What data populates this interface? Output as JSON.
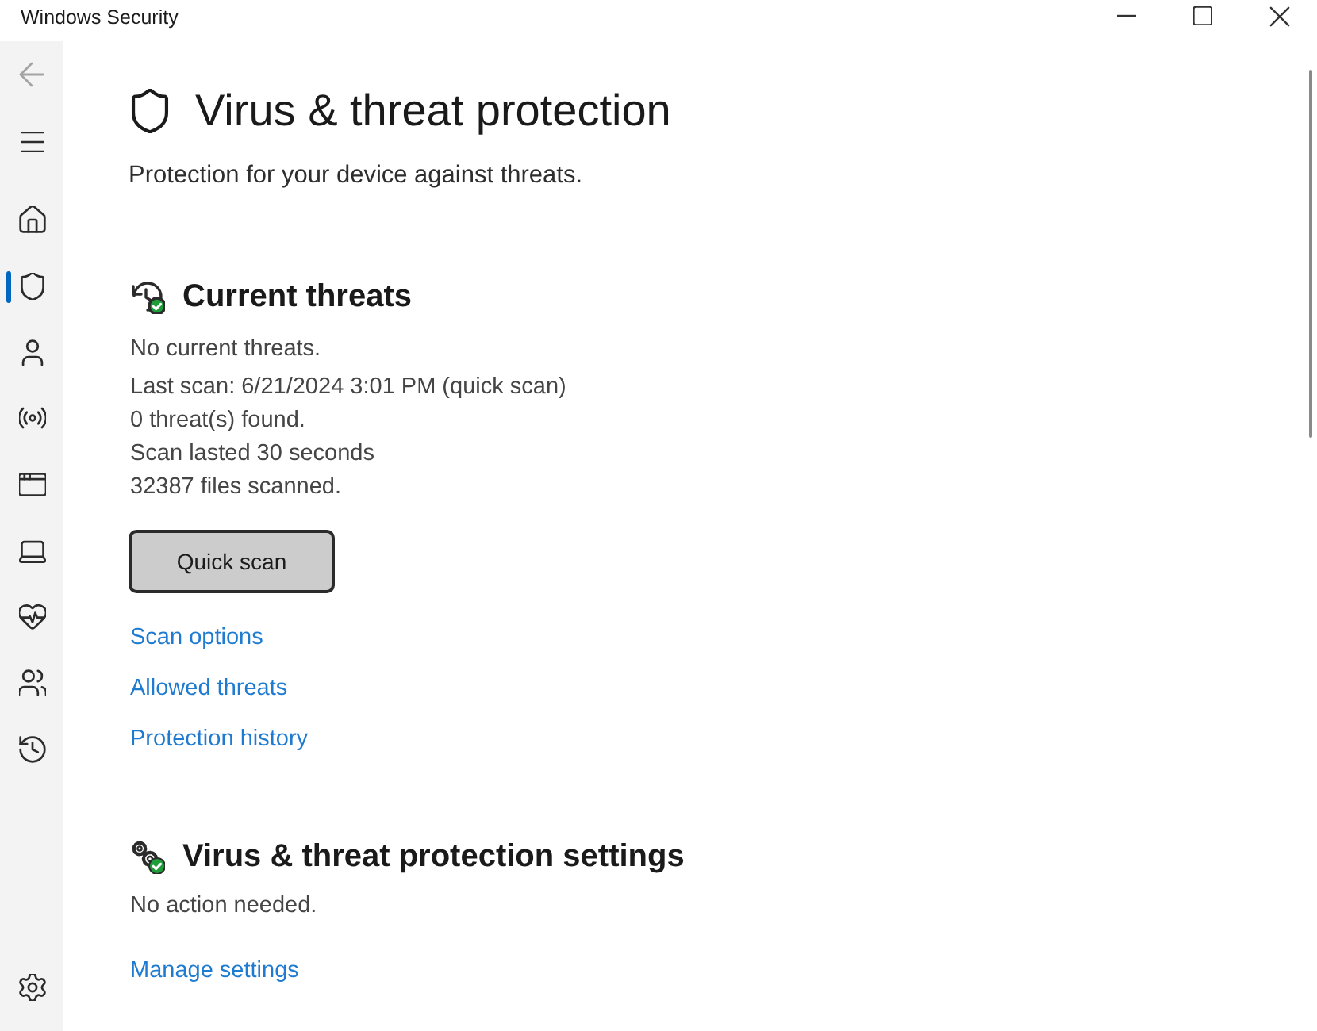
{
  "window": {
    "title": "Windows Security"
  },
  "sidebar": {
    "back": {
      "disabled": true
    },
    "items": [
      {
        "kind": "home",
        "selected": false
      },
      {
        "kind": "shield",
        "selected": true
      },
      {
        "kind": "account",
        "selected": false
      },
      {
        "kind": "network",
        "selected": false
      },
      {
        "kind": "app",
        "selected": false
      },
      {
        "kind": "device",
        "selected": false
      },
      {
        "kind": "health",
        "selected": false
      },
      {
        "kind": "family",
        "selected": false
      },
      {
        "kind": "history",
        "selected": false
      }
    ],
    "footer": [
      {
        "kind": "settings",
        "selected": false
      }
    ]
  },
  "page": {
    "title": "Virus & threat protection",
    "subtitle": "Protection for your device against threats."
  },
  "sections": [
    {
      "kind": "threats",
      "title": "Current threats",
      "status": "No current threats.",
      "details": [
        "Last scan: 6/21/2024 3:01 PM (quick scan)",
        "0 threat(s) found.",
        "Scan lasted 30 seconds",
        "32387 files scanned."
      ],
      "button": "Quick scan",
      "links": [
        "Scan options",
        "Allowed threats",
        "Protection history"
      ]
    },
    {
      "kind": "settings",
      "title": "Virus & threat protection settings",
      "status": "No action needed.",
      "links": [
        "Manage settings"
      ]
    }
  ]
}
